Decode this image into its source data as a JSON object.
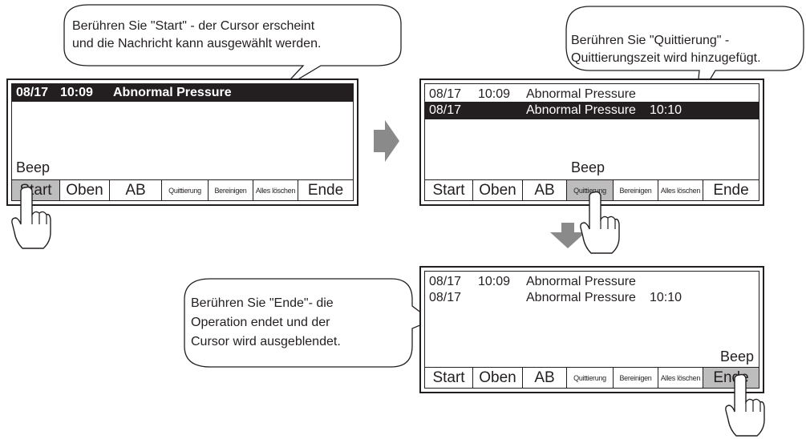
{
  "buttons": [
    "Start",
    "Oben",
    "AB",
    "Quittierung",
    "Bereinigen",
    "Alles löschen",
    "Ende"
  ],
  "beep_label": "Beep",
  "step1": {
    "bubble": [
      "Berühren Sie \"Start\" - der Cursor erscheint",
      "und die Nachricht kann ausgewählt werden."
    ],
    "row1": {
      "date": "08/17",
      "time": "10:09",
      "msg": "Abnormal Pressure"
    }
  },
  "step2": {
    "bubble": [
      "Berühren Sie \"Quittierung\" -",
      "Quittierungszeit wird hinzugefügt."
    ],
    "row1": {
      "date": "08/17",
      "time": "10:09",
      "msg": "Abnormal Pressure"
    },
    "row2": {
      "date": "08/17",
      "msg": "Abnormal Pressure",
      "ack": "10:10"
    }
  },
  "step3": {
    "bubble": [
      "Berühren Sie \"Ende\"- die",
      "Operation endet und der",
      "Cursor wird ausgeblendet."
    ],
    "row1": {
      "date": "08/17",
      "time": "10:09",
      "msg": "Abnormal Pressure"
    },
    "row2": {
      "date": "08/17",
      "msg": "Abnormal Pressure",
      "ack": "10:10"
    }
  },
  "colors": {
    "outline": "#231f20",
    "highlight": "#231f20",
    "pressed": "#bdbdbd",
    "arrow": "#8a8a8a"
  }
}
